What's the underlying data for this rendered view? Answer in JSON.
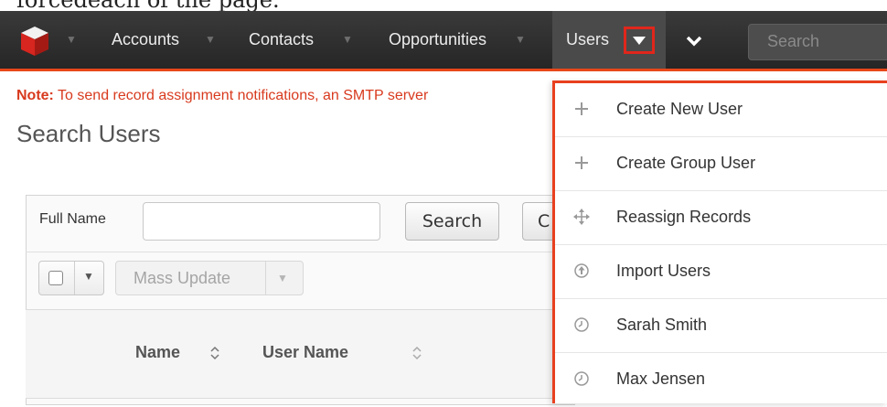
{
  "caption_fragment": "forcedeach of the page.",
  "nav": {
    "items": [
      "Accounts",
      "Contacts",
      "Opportunities",
      "Users"
    ],
    "search_placeholder": "Search"
  },
  "note": {
    "label": "Note:",
    "text": " To send record assignment notifications, an SMTP server"
  },
  "page_title": "Search Users",
  "filter": {
    "fullname_label": "Full Name",
    "fullname_value": "",
    "search_button": "Search",
    "clear_button_partial": "C"
  },
  "toolbar": {
    "mass_update": "Mass Update"
  },
  "table": {
    "columns": [
      "Name",
      "User Name"
    ]
  },
  "dropdown": {
    "items": [
      {
        "label": "Create New User",
        "icon": "plus-icon"
      },
      {
        "label": "Create Group User",
        "icon": "plus-icon"
      },
      {
        "label": "Reassign Records",
        "icon": "move-arrows-icon"
      },
      {
        "label": "Import Users",
        "icon": "upload-circle-icon"
      },
      {
        "label": "Sarah Smith",
        "icon": "clock-icon"
      },
      {
        "label": "Max Jensen",
        "icon": "clock-icon"
      }
    ]
  },
  "colors": {
    "accent": "#e8401f",
    "highlight_box": "#e0261b",
    "navbar": "#2f2f2f"
  }
}
